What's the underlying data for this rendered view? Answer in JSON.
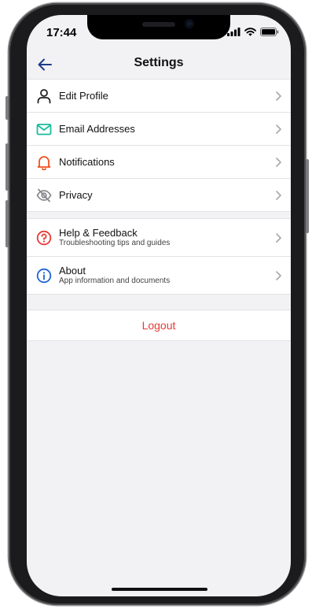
{
  "status_bar": {
    "time": "17:44"
  },
  "header": {
    "title": "Settings"
  },
  "settings_group_1": [
    {
      "label": "Edit Profile",
      "icon": "user-icon",
      "color": "#222222"
    },
    {
      "label": "Email Addresses",
      "icon": "envelope-icon",
      "color": "#1abc9c"
    },
    {
      "label": "Notifications",
      "icon": "bell-icon",
      "color": "#f4511e"
    },
    {
      "label": "Privacy",
      "icon": "eye-slash-icon",
      "color": "#8a8a8e"
    }
  ],
  "settings_group_2": [
    {
      "label": "Help & Feedback",
      "sublabel": "Troubleshooting tips and guides",
      "icon": "question-circle-icon",
      "color": "#e53935"
    },
    {
      "label": "About",
      "sublabel": "App information and documents",
      "icon": "info-circle-icon",
      "color": "#1e63d6"
    }
  ],
  "logout": {
    "label": "Logout",
    "color": "#e53935"
  }
}
